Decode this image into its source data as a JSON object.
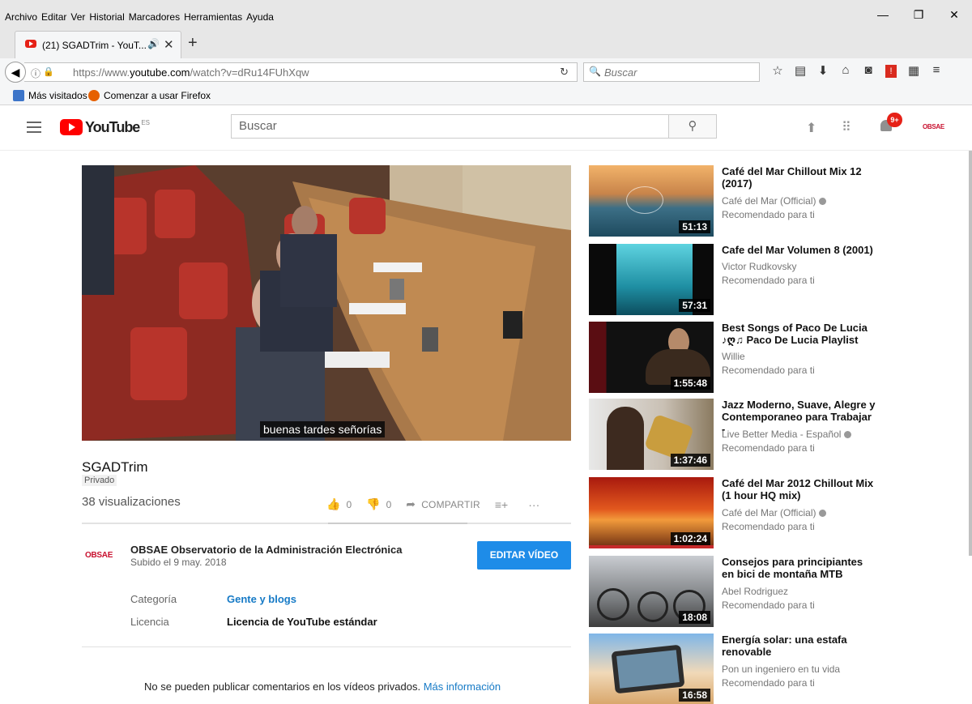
{
  "browser": {
    "menu": [
      "Archivo",
      "Editar",
      "Ver",
      "Historial",
      "Marcadores",
      "Herramientas",
      "Ayuda"
    ],
    "window_controls": [
      "—",
      "❐",
      "✕"
    ],
    "tab": {
      "title": "(21) SGADTrim - YouT...",
      "sound_icon": "🔊",
      "close": "✕"
    },
    "new_tab": "+",
    "url": {
      "prefix": "https://www.",
      "domain": "youtube.com",
      "path": "/watch?v=dRu14FUhXqw"
    },
    "search_placeholder": "Buscar",
    "bookmarks": [
      {
        "label": "Más visitados",
        "icon": "most-visited-icon",
        "color": "#3d75c9"
      },
      {
        "label": "Comenzar a usar Firefox",
        "icon": "firefox-icon",
        "color": "#e66000"
      }
    ]
  },
  "youtube": {
    "logo_text": "YouTube",
    "logo_region": "ES",
    "search_placeholder": "Buscar",
    "notification_badge": "9+",
    "account_label": "OBSAE"
  },
  "video": {
    "title": "SGADTrim",
    "privacy": "Privado",
    "views": "38 visualizaciones",
    "likes": "0",
    "dislikes": "0",
    "share_label": "COMPARTIR",
    "caption": "buenas tardes señorías",
    "channel": {
      "logo": "OBSAE",
      "name": "OBSAE Observatorio de la Administración Electrónica",
      "date": "Subido el 9 may. 2018"
    },
    "edit_button": "EDITAR VÍDEO",
    "category_label": "Categoría",
    "category_value": "Gente y blogs",
    "license_label": "Licencia",
    "license_value": "Licencia de YouTube estándar",
    "comments_notice": "No se pueden publicar comentarios en los vídeos privados.",
    "comments_link": "Más información"
  },
  "recommendations": [
    {
      "title": "Café del Mar Chillout Mix 12 (2017)",
      "channel": "Café del Mar (Official)",
      "verified": true,
      "label": "Recomendado para ti",
      "duration": "51:13"
    },
    {
      "title": "Cafe del Mar Volumen 8 (2001)",
      "channel": "Victor Rudkovsky",
      "verified": false,
      "label": "Recomendado para ti",
      "duration": "57:31"
    },
    {
      "title": "Best Songs of Paco De Lucia ♪ღ♫ Paco De Lucia Playlist",
      "channel": "Willie",
      "verified": false,
      "label": "Recomendado para ti",
      "duration": "1:55:48"
    },
    {
      "title": "Jazz Moderno, Suave, Alegre y Contemporaneo para Trabajar -",
      "channel": "Live Better Media - Español",
      "verified": true,
      "label": "Recomendado para ti",
      "duration": "1:37:46"
    },
    {
      "title": "Café del Mar 2012 Chillout Mix (1 hour HQ mix)",
      "channel": "Café del Mar (Official)",
      "verified": true,
      "label": "Recomendado para ti",
      "duration": "1:02:24"
    },
    {
      "title": "Consejos para principiantes en bici de montaña MTB",
      "channel": "Abel Rodriguez",
      "verified": false,
      "label": "Recomendado para ti",
      "duration": "18:08"
    },
    {
      "title": "Energía solar: una estafa renovable",
      "channel": "Pon un ingeniero en tu vida",
      "verified": false,
      "label": "Recomendado para ti",
      "duration": "16:58"
    }
  ]
}
